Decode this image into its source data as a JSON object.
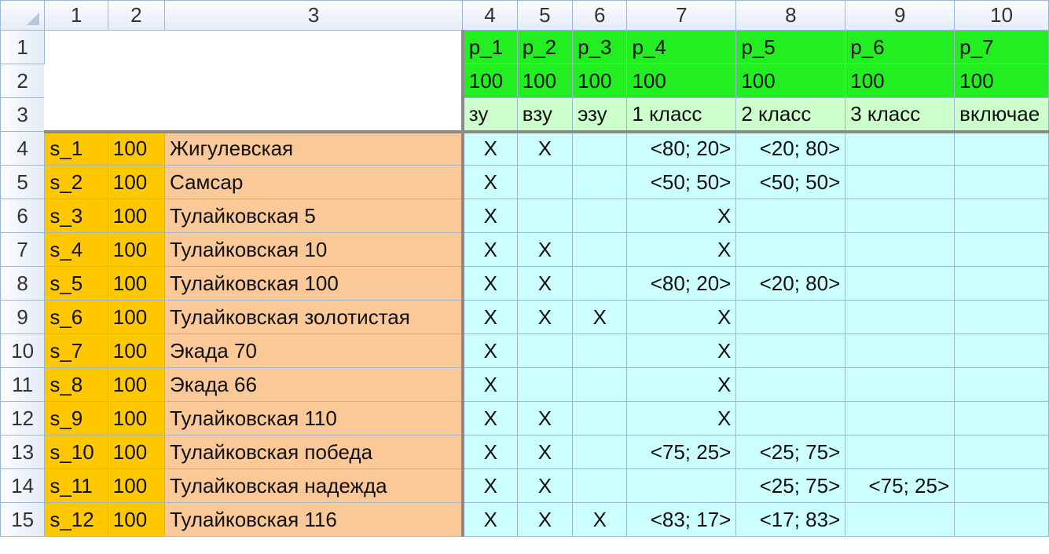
{
  "column_headers": [
    "1",
    "2",
    "3",
    "4",
    "5",
    "6",
    "7",
    "8",
    "9",
    "10"
  ],
  "params": {
    "names": [
      "p_1",
      "p_2",
      "p_3",
      "p_4",
      "p_5",
      "p_6",
      "p_7"
    ],
    "values": [
      "100",
      "100",
      "100",
      "100",
      "100",
      "100",
      "100"
    ],
    "descriptions": [
      "зу",
      "взу",
      "эзу",
      "1 класс",
      "2 класс",
      "3 класс",
      "включае"
    ]
  },
  "rows": [
    {
      "n": "4",
      "id": "s_1",
      "v": "100",
      "name": "Жигулевская",
      "c": [
        "X",
        "X",
        "",
        "<80; 20>",
        "<20; 80>",
        "",
        ""
      ]
    },
    {
      "n": "5",
      "id": "s_2",
      "v": "100",
      "name": "Самсар",
      "c": [
        "X",
        "",
        "",
        "<50; 50>",
        "<50; 50>",
        "",
        ""
      ]
    },
    {
      "n": "6",
      "id": "s_3",
      "v": "100",
      "name": "Тулайковская 5",
      "c": [
        "X",
        "",
        "",
        "X",
        "",
        "",
        ""
      ]
    },
    {
      "n": "7",
      "id": "s_4",
      "v": "100",
      "name": "Тулайковская 10",
      "c": [
        "X",
        "X",
        "",
        "X",
        "",
        "",
        ""
      ]
    },
    {
      "n": "8",
      "id": "s_5",
      "v": "100",
      "name": "Тулайковская 100",
      "c": [
        "X",
        "X",
        "",
        "<80; 20>",
        "<20; 80>",
        "",
        ""
      ]
    },
    {
      "n": "9",
      "id": "s_6",
      "v": "100",
      "name": "Тулайковская золотистая",
      "c": [
        "X",
        "X",
        "X",
        "X",
        "",
        "",
        ""
      ]
    },
    {
      "n": "10",
      "id": "s_7",
      "v": "100",
      "name": "Экада 70",
      "c": [
        "X",
        "",
        "",
        "X",
        "",
        "",
        ""
      ]
    },
    {
      "n": "11",
      "id": "s_8",
      "v": "100",
      "name": "Экада 66",
      "c": [
        "X",
        "",
        "",
        "X",
        "",
        "",
        ""
      ]
    },
    {
      "n": "12",
      "id": "s_9",
      "v": "100",
      "name": "Тулайковская 110",
      "c": [
        "X",
        "X",
        "",
        "X",
        "",
        "",
        ""
      ]
    },
    {
      "n": "13",
      "id": "s_10",
      "v": "100",
      "name": "Тулайковская победа",
      "c": [
        "X",
        "X",
        "",
        "<75; 25>",
        "<25; 75>",
        "",
        ""
      ]
    },
    {
      "n": "14",
      "id": "s_11",
      "v": "100",
      "name": "Тулайковская надежда",
      "c": [
        "X",
        "X",
        "",
        "",
        "<25; 75>",
        "<75; 25>",
        ""
      ]
    },
    {
      "n": "15",
      "id": "s_12",
      "v": "100",
      "name": "Тулайковская 116",
      "c": [
        "X",
        "X",
        "X",
        "<83; 17>",
        "<17; 83>",
        "",
        ""
      ]
    }
  ]
}
